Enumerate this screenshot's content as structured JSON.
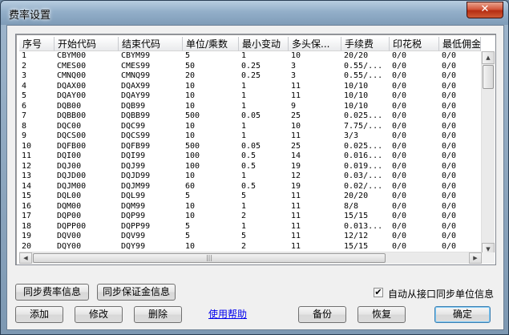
{
  "window": {
    "title": "费率设置",
    "close_glyph": "✕"
  },
  "table": {
    "columns": [
      "序号",
      "开始代码",
      "结束代码",
      "单位/乘数",
      "最小变动",
      "多头保...",
      "手续费",
      "印花税",
      "最低佣金"
    ],
    "rows": [
      [
        "1",
        "CBYM00",
        "CBYM99",
        "5",
        "1",
        "10",
        "20/20",
        "0/0",
        "0/0"
      ],
      [
        "2",
        "CMES00",
        "CMES99",
        "50",
        "0.25",
        "3",
        "0.55/...",
        "0/0",
        "0/0"
      ],
      [
        "3",
        "CMNQ00",
        "CMNQ99",
        "20",
        "0.25",
        "3",
        "0.55/...",
        "0/0",
        "0/0"
      ],
      [
        "4",
        "DQAX00",
        "DQAX99",
        "10",
        "1",
        "11",
        "10/10",
        "0/0",
        "0/0"
      ],
      [
        "5",
        "DQAY00",
        "DQAY99",
        "10",
        "1",
        "11",
        "10/10",
        "0/0",
        "0/0"
      ],
      [
        "6",
        "DQB00",
        "DQB99",
        "10",
        "1",
        "9",
        "10/10",
        "0/0",
        "0/0"
      ],
      [
        "7",
        "DQBB00",
        "DQBB99",
        "500",
        "0.05",
        "25",
        "0.025...",
        "0/0",
        "0/0"
      ],
      [
        "8",
        "DQC00",
        "DQC99",
        "10",
        "1",
        "10",
        "7.75/...",
        "0/0",
        "0/0"
      ],
      [
        "9",
        "DQCS00",
        "DQCS99",
        "10",
        "1",
        "11",
        "3/3",
        "0/0",
        "0/0"
      ],
      [
        "10",
        "DQFB00",
        "DQFB99",
        "500",
        "0.05",
        "25",
        "0.025...",
        "0/0",
        "0/0"
      ],
      [
        "11",
        "DQI00",
        "DQI99",
        "100",
        "0.5",
        "14",
        "0.016...",
        "0/0",
        "0/0"
      ],
      [
        "12",
        "DQJ00",
        "DQJ99",
        "100",
        "0.5",
        "19",
        "0.019...",
        "0/0",
        "0/0"
      ],
      [
        "13",
        "DQJD00",
        "DQJD99",
        "10",
        "1",
        "12",
        "0.03/...",
        "0/0",
        "0/0"
      ],
      [
        "14",
        "DQJM00",
        "DQJM99",
        "60",
        "0.5",
        "19",
        "0.02/...",
        "0/0",
        "0/0"
      ],
      [
        "15",
        "DQL00",
        "DQL99",
        "5",
        "5",
        "11",
        "20/20",
        "0/0",
        "0/0"
      ],
      [
        "16",
        "DQM00",
        "DQM99",
        "10",
        "1",
        "11",
        "8/8",
        "0/0",
        "0/0"
      ],
      [
        "17",
        "DQP00",
        "DQP99",
        "10",
        "2",
        "11",
        "15/15",
        "0/0",
        "0/0"
      ],
      [
        "18",
        "DQPP00",
        "DQPP99",
        "5",
        "1",
        "11",
        "0.013...",
        "0/0",
        "0/0"
      ],
      [
        "19",
        "DQV00",
        "DQV99",
        "5",
        "5",
        "11",
        "12/12",
        "0/0",
        "0/0"
      ],
      [
        "20",
        "DQY00",
        "DQY99",
        "10",
        "2",
        "11",
        "15/15",
        "0/0",
        "0/0"
      ]
    ]
  },
  "buttons": {
    "sync_rate": "同步费率信息",
    "sync_margin": "同步保证金信息",
    "add": "添加",
    "edit": "修改",
    "delete": "删除",
    "help": "使用帮助",
    "backup": "备份",
    "restore": "恢复",
    "ok": "确定"
  },
  "auto_sync": {
    "label": "自动从接口同步单位信息",
    "checked": true,
    "check_glyph": "✔"
  }
}
